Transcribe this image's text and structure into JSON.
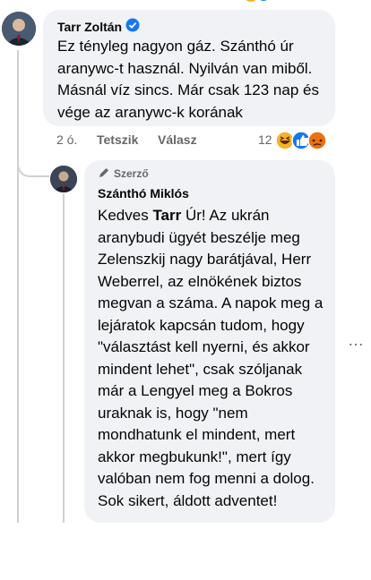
{
  "comment": {
    "author": "Tarr Zoltán",
    "verified_icon": "verified-badge-icon",
    "text": "Ez tényleg nagyon gáz. Szánthó úr aranywc-t használ. Nyilván van miből. Másnál víz sincs. Már csak 123 nap és vége az aranywc-k korának",
    "time": "2 ó.",
    "like_label": "Tetszik",
    "reply_label": "Válasz",
    "reaction_count": "12",
    "reactions": [
      "haha",
      "like",
      "angry"
    ]
  },
  "reply": {
    "author_badge": "Szerző",
    "author": "Szánthó Miklós",
    "text_prefix": "Kedves ",
    "text_bold": "Tarr",
    "text_rest": " Úr! Az ukrán aranybudi ügyét beszélje meg Zelenszkij nagy barátjával, Herr Weberrel, az elnökének biztos megvan a száma. A napok meg a lejáratok kapcsán tudom, hogy \"választást kell nyerni, és akkor mindent lehet\", csak szóljanak már a Lengyel meg a Bokros uraknak is, hogy \"nem mondhatunk el mindent, mert akkor megbukunk!\", mert így valóban nem fog menni a dolog. Sok sikert, áldott adventet!"
  },
  "more_options": "…",
  "colors": {
    "bubble": "#f0f2f5",
    "meta": "#65676b",
    "like_blue": "#1877f2",
    "angry": "#e9710f",
    "haha": "#f7b125"
  }
}
